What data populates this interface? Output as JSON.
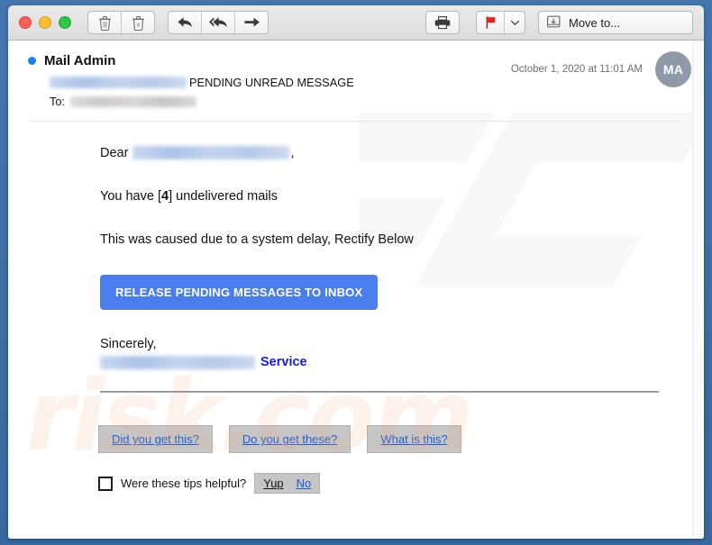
{
  "window": {
    "traffic_lights": [
      "close",
      "minimize",
      "zoom"
    ]
  },
  "toolbar": {
    "delete_label": "Delete",
    "junk_label": "Junk",
    "reply_label": "Reply",
    "reply_all_label": "Reply All",
    "forward_label": "Forward",
    "print_label": "Print",
    "flag_label": "Flag",
    "flag_menu_label": "Flag options",
    "move_to_label": "Move to...",
    "flag_color": "#ee2020"
  },
  "message": {
    "sender": "Mail Admin",
    "unread": true,
    "subject_suffix": "PENDING UNREAD MESSAGE",
    "subject_redacted": true,
    "to_label": "To:",
    "to_redacted": true,
    "date": "October 1, 2020 at 11:01 AM",
    "avatar_initials": "MA",
    "avatar_color": "#9099a8"
  },
  "body": {
    "greeting_prefix": "Dear",
    "greeting_suffix": ",",
    "greeting_redacted": true,
    "line_undelivered_prefix": "You have [",
    "line_undelivered_count": "4",
    "line_undelivered_suffix": "] undelivered mails",
    "line_cause": "This was caused due to a system delay, Rectify Below",
    "cta_label": "RELEASE PENDING MESSAGES TO INBOX",
    "cta_color": "#4a7dee",
    "signoff": "Sincerely,",
    "signature_redacted": true,
    "signature_service": "Service",
    "signature_service_color": "#1a18ef"
  },
  "footer": {
    "buttons": [
      {
        "label": "Did you get this?"
      },
      {
        "label": "Do you get these?"
      },
      {
        "label": "What is this?"
      }
    ],
    "tips_question": "Were these tips helpful?",
    "tips_yes": "Yup",
    "tips_no": "No"
  },
  "watermark": {
    "text": "risk.com",
    "logo": "PC"
  }
}
